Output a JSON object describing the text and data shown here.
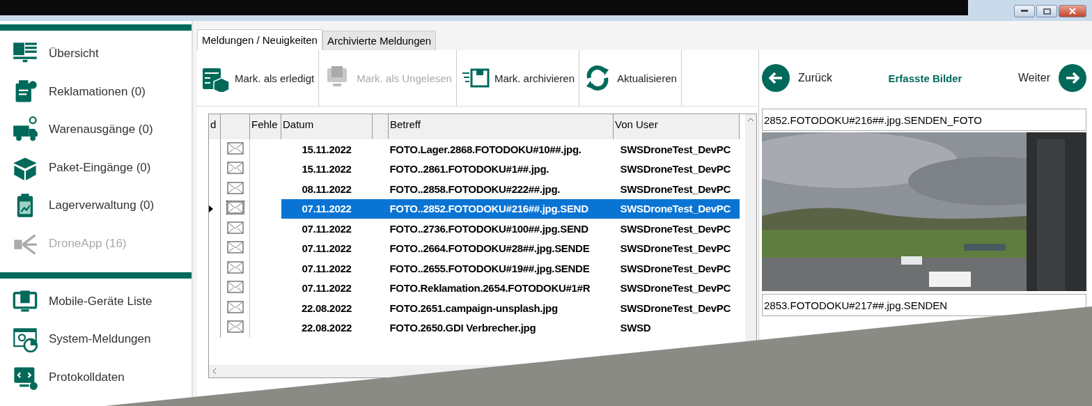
{
  "sidebar": {
    "groups": [
      [
        {
          "label": "Übersicht",
          "disabled": false
        },
        {
          "label": "Reklamationen (0)",
          "disabled": false
        },
        {
          "label": "Warenausgänge (0)",
          "disabled": false
        },
        {
          "label": "Paket-Eingänge (0)",
          "disabled": false
        },
        {
          "label": "Lagerverwaltung (0)",
          "disabled": false
        },
        {
          "label": "DroneApp (16)",
          "disabled": true
        }
      ],
      [
        {
          "label": "Mobile-Geräte Liste",
          "disabled": false
        },
        {
          "label": "System-Meldungen",
          "disabled": false
        },
        {
          "label": "Protokolldaten",
          "disabled": false
        }
      ]
    ]
  },
  "tabs": [
    {
      "label": "Meldungen / Neuigkeiten",
      "selected": true
    },
    {
      "label": "Archivierte Meldungen",
      "selected": false
    }
  ],
  "toolbar": [
    {
      "label": "Mark. als erledigt",
      "disabled": false
    },
    {
      "label": "Mark. als Ungelesen",
      "disabled": true
    },
    {
      "label": "Mark. archivieren",
      "disabled": false
    },
    {
      "label": "Aktualisieren",
      "disabled": false
    }
  ],
  "table": {
    "columns": [
      "d",
      "",
      "Fehle",
      "Datum",
      "",
      "Betreff",
      "Von User"
    ],
    "rows": [
      {
        "datum": "15.11.2022",
        "betreff": "FOTO.Lager.2868.FOTODOKU#10##.jpg.",
        "user": "SWSDroneTest_DevPC",
        "selected": false
      },
      {
        "datum": "15.11.2022",
        "betreff": "FOTO..2861.FOTODOKU#1##.jpg.",
        "user": "SWSDroneTest_DevPC",
        "selected": false
      },
      {
        "datum": "08.11.2022",
        "betreff": "FOTO..2858.FOTODOKU#222##.jpg.",
        "user": "SWSDroneTest_DevPC",
        "selected": false
      },
      {
        "datum": "07.11.2022",
        "betreff": "FOTO..2852.FOTODOKU#216##.jpg.SEND",
        "user": "SWSDroneTest_DevPC",
        "selected": true
      },
      {
        "datum": "07.11.2022",
        "betreff": "FOTO..2736.FOTODOKU#100##.jpg.SEND",
        "user": "SWSDroneTest_DevPC",
        "selected": false
      },
      {
        "datum": "07.11.2022",
        "betreff": "FOTO..2664.FOTODOKU#28##.jpg.SENDE",
        "user": "SWSDroneTest_DevPC",
        "selected": false
      },
      {
        "datum": "07.11.2022",
        "betreff": "FOTO..2655.FOTODOKU#19##.jpg.SENDE",
        "user": "SWSDroneTest_DevPC",
        "selected": false
      },
      {
        "datum": "07.11.2022",
        "betreff": "FOTO.Reklamation.2654.FOTODOKU#1#R",
        "user": "SWSDroneTest_DevPC",
        "selected": false
      },
      {
        "datum": "22.08.2022",
        "betreff": "FOTO.2651.campaign-unsplash.jpg",
        "user": "SWSDroneTest_DevPC",
        "selected": false
      },
      {
        "datum": "22.08.2022",
        "betreff": "FOTO.2650.GDI Verbrecher.jpg",
        "user": "SWSD",
        "selected": false
      }
    ]
  },
  "viewer": {
    "back": "Zurück",
    "title": "Erfasste Bilder",
    "next": "Weiter",
    "captions": [
      "2852.FOTODOKU#216##.jpg.SENDEN_FOTO",
      "2853.FOTODOKU#217##.jpg.SENDEN"
    ],
    "image": {
      "kind": "picture"
    }
  }
}
